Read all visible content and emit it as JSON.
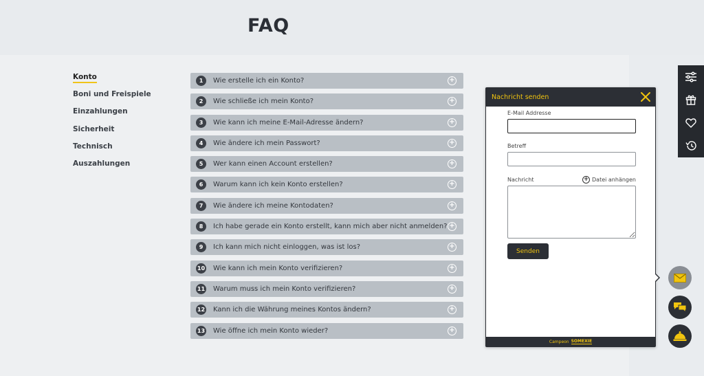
{
  "page": {
    "title": "FAQ"
  },
  "categories": [
    {
      "label": "Konto",
      "active": true
    },
    {
      "label": "Boni und Freispiele"
    },
    {
      "label": "Einzahlungen"
    },
    {
      "label": "Sicherheit"
    },
    {
      "label": "Technisch"
    },
    {
      "label": "Auszahlungen"
    }
  ],
  "faq": [
    {
      "num": "1",
      "q": "Wie erstelle ich ein Konto?"
    },
    {
      "num": "2",
      "q": "Wie schließe ich mein Konto?"
    },
    {
      "num": "3",
      "q": "Wie kann ich meine E-Mail-Adresse ändern?"
    },
    {
      "num": "4",
      "q": "Wie ändere ich mein Passwort?"
    },
    {
      "num": "5",
      "q": "Wer kann einen Account erstellen?"
    },
    {
      "num": "6",
      "q": "Warum kann ich kein Konto erstellen?"
    },
    {
      "num": "7",
      "q": "Wie ändere ich meine Kontodaten?"
    },
    {
      "num": "8",
      "q": "Ich habe gerade ein Konto erstellt, kann mich aber nicht anmelden?"
    },
    {
      "num": "9",
      "q": "Ich kann mich nicht einloggen, was ist los?"
    },
    {
      "num": "10",
      "q": "Wie kann ich mein Konto verifizieren?"
    },
    {
      "num": "11",
      "q": "Warum muss ich mein Konto verifizieren?"
    },
    {
      "num": "12",
      "q": "Kann ich die Währung meines Kontos ändern?"
    },
    {
      "num": "13",
      "q": "Wie öffne ich mein Konto wieder?"
    }
  ],
  "chat": {
    "title": "Nachricht senden",
    "email_label": "E-Mail Addresse",
    "email_value": "",
    "subject_label": "Betreff",
    "subject_value": "",
    "message_label": "Nachricht",
    "attach_label": "Datei anhängen",
    "send_label": "Senden",
    "footer_powered": "Campeon",
    "footer_brand": "SOMEXIE"
  },
  "colors": {
    "accent": "#f1c40f",
    "dark": "#2c2f35",
    "faq_bg": "#b9bfc5"
  },
  "icons": {
    "sidebar": [
      "sliders-icon",
      "gift-icon",
      "heart-icon",
      "history-icon"
    ],
    "fabs": [
      "mail-icon",
      "chat-bubbles-icon",
      "bell-icon"
    ]
  }
}
